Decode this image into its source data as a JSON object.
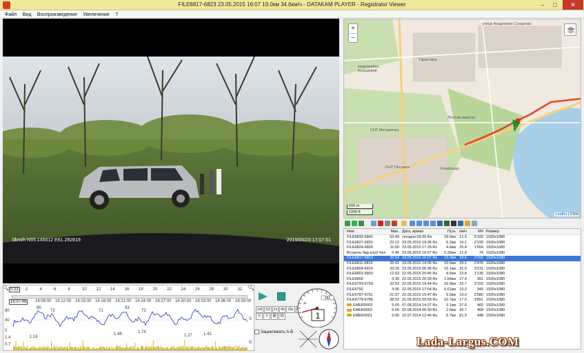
{
  "window": {
    "title": "FILE6817-6823   23.05.2015 16:07   19.0км   34.6км/ч  -  DATAKAM PLAYER - Registrator Viewer",
    "minimize": "–",
    "maximize": "□",
    "close": "✕"
  },
  "menu": [
    "Файл",
    "Вид",
    "Воспроизведение",
    "Увеличение",
    "?"
  ],
  "video": {
    "overlay_left": "0km/h N55.145012 E61.292819",
    "overlay_right": "2015/05/23 17:07:51"
  },
  "timeline": {
    "zoom_out": "−",
    "zoom_in": "+",
    "ruler_current": "0:23",
    "ruler_ticks": [
      "2",
      "4",
      "6",
      "8",
      "10",
      "12",
      "14",
      "16",
      "18",
      "20",
      "22",
      "24",
      "26",
      "28",
      "30",
      "32"
    ],
    "time_current": "16:07:48",
    "time_ticks": [
      "16:09:00",
      "16:12:00",
      "16:15:00",
      "16:18:00",
      "16:21:00",
      "16:24:00",
      "16:27:00",
      "16:30:00",
      "16:33:00",
      "16:36:00",
      "16:39:00"
    ],
    "speed_axis": [
      "80",
      "40",
      "0"
    ],
    "speed_unit": "S",
    "speed_peaks": [
      "85",
      "72",
      "83",
      "71",
      "72"
    ],
    "g_axis": [
      "1.4",
      "0.7"
    ],
    "g_unit": "G",
    "g_peaks": [
      "1.16",
      "1.48",
      "1.74",
      "1.27",
      "1.42"
    ]
  },
  "controls": {
    "speeds": [
      "1/4",
      "1/2",
      "1x",
      "4x",
      "16x",
      "64x"
    ],
    "nav": [
      "<",
      ">",
      "⊕",
      "⊖"
    ],
    "loop_label": "Зацикливать A-B",
    "gauge_value": "1",
    "gauge_odometer": "251",
    "gauge_small": "30"
  },
  "map": {
    "zoom_in": "+",
    "zoom_out": "−",
    "scale_m": "500 m",
    "scale_ft": "1000 ft",
    "attribution_link": "Leaflet",
    "attribution_rest": "| OSM",
    "labels": {
      "street_top": "улица Академика Сахарова",
      "district": "микрорайон Кольцевой",
      "lake": "Тарасовка",
      "snt1": "СНТ Мичуринец",
      "snt2": "СНТ Петушок",
      "snt3": "Кладбище",
      "snt4": "Лесной квартал"
    }
  },
  "file_list": {
    "headers": {
      "name": "Имя",
      "min": "Мин.",
      "date": "Дата, время",
      "path": "Путь",
      "kmh": "км/ч",
      "mb": "Мб",
      "size": "Размер"
    },
    "rows": [
      {
        "name": "FILE6832-6842",
        "min": "53:49",
        "date": "сегодня 09:39 Rs",
        "path": "18.0км",
        "kmh": "21.3",
        "mb": "5'183",
        "size": "1920x1080",
        "type": "video"
      },
      {
        "name": "FILE6827-6831",
        "min": "23:12",
        "date": "23.05.2015 19:06 Rs",
        "path": "6.2км",
        "kmh": "16.1",
        "mb": "2'190",
        "size": "1920x1080",
        "type": "video"
      },
      {
        "name": "FILE6824-6826",
        "min": "11:50",
        "date": "23.05.2015 17:29 Rs",
        "path": "4.6км",
        "kmh": "25.4",
        "mb": "1'054",
        "size": "1920x1080",
        "type": "video"
      },
      {
        "name": "Встреча Лар.клуб Челябинск",
        "min": "0:46",
        "date": "23.05.2015 16:07 Rs",
        "path": "0.28км",
        "kmh": "21.9",
        "mb": "74",
        "size": "1920x1080",
        "type": "video"
      },
      {
        "name": "FILE6817-6823",
        "min": "32:54",
        "date": "23.05.2015 16:07 Rs",
        "path": "19.0км",
        "kmh": "34.6",
        "mb": "3'153",
        "size": "1920x1080",
        "type": "video",
        "selected": true
      },
      {
        "name": "FILE6811-6816",
        "min": "25:41",
        "date": "23.05.2015 14:06 Rs",
        "path": "10.5км",
        "kmh": "25.1",
        "mb": "2'476",
        "size": "1920x1080",
        "type": "video"
      },
      {
        "name": "FILE6804-6810",
        "min": "33:26",
        "date": "23.05.2015 06:36 Rs",
        "path": "16.1км",
        "kmh": "31.9",
        "mb": "3'231",
        "size": "1920x1080",
        "type": "video"
      },
      {
        "name": "FILE6801-6803",
        "min": "12:03",
        "date": "22.05.2015 20:45 Rs",
        "path": "4.5км",
        "kmh": "22.8",
        "mb": "1'135",
        "size": "1920x1080",
        "type": "video"
      },
      {
        "name": "FILE6800",
        "min": "3:39",
        "date": "22.05.2015 20:28 Rs",
        "path": "1.64км",
        "kmh": "27.4",
        "mb": "351",
        "size": "1920x1080",
        "type": "video"
      },
      {
        "name": "FILE6793-6799",
        "min": "32:53",
        "date": "22.05.2015 19:44 Rs",
        "path": "16.9км",
        "kmh": "32.7",
        "mb": "3'150",
        "size": "1920x1080",
        "type": "video"
      },
      {
        "name": "FILE6792",
        "min": "3:36",
        "date": "22.05.2015 17:04 Rs",
        "path": "0.61км",
        "kmh": "10.2",
        "mb": "343",
        "size": "1920x1080",
        "type": "video"
      },
      {
        "name": "FILE6787-6791",
        "min": "21:37",
        "date": "22.05.2015 15:47 Rs",
        "path": "5.5км",
        "kmh": "16.0",
        "mb": "2'080",
        "size": "1920x1080",
        "type": "video"
      },
      {
        "name": "FILE6779-6786",
        "min": "38:02",
        "date": "21.05.2015 09:59 Rs",
        "path": "10.7км",
        "kmh": "17.0",
        "mb": "3'651",
        "size": "1920x1080",
        "type": "video"
      },
      {
        "name": "EMER0003",
        "min": "5:00",
        "date": "07.08.2014 14:37 Rs",
        "path": "3.1км",
        "kmh": "37.6",
        "mb": "482",
        "size": "1920x1080",
        "type": "emer"
      },
      {
        "name": "EMER0002",
        "min": "5:00",
        "date": "02.08.2014 06:39 Rs",
        "path": "2.6км",
        "kmh": "30.7",
        "mb": "468",
        "size": "1920x1080",
        "type": "emer"
      },
      {
        "name": "EMER0001",
        "min": "5:00",
        "date": "22.07.2014 12:46 Rs",
        "path": "6.7км",
        "kmh": "81.0",
        "mb": "448",
        "size": "1920x1080",
        "type": "emer"
      }
    ]
  },
  "watermark": "Lada-Largus.COM",
  "colors": {
    "titlebar": "#f0e89a",
    "accent_select": "#3a78d8",
    "speed_line": "#2030c0",
    "g_bars": "#c9a100",
    "route": "#e0452a"
  }
}
